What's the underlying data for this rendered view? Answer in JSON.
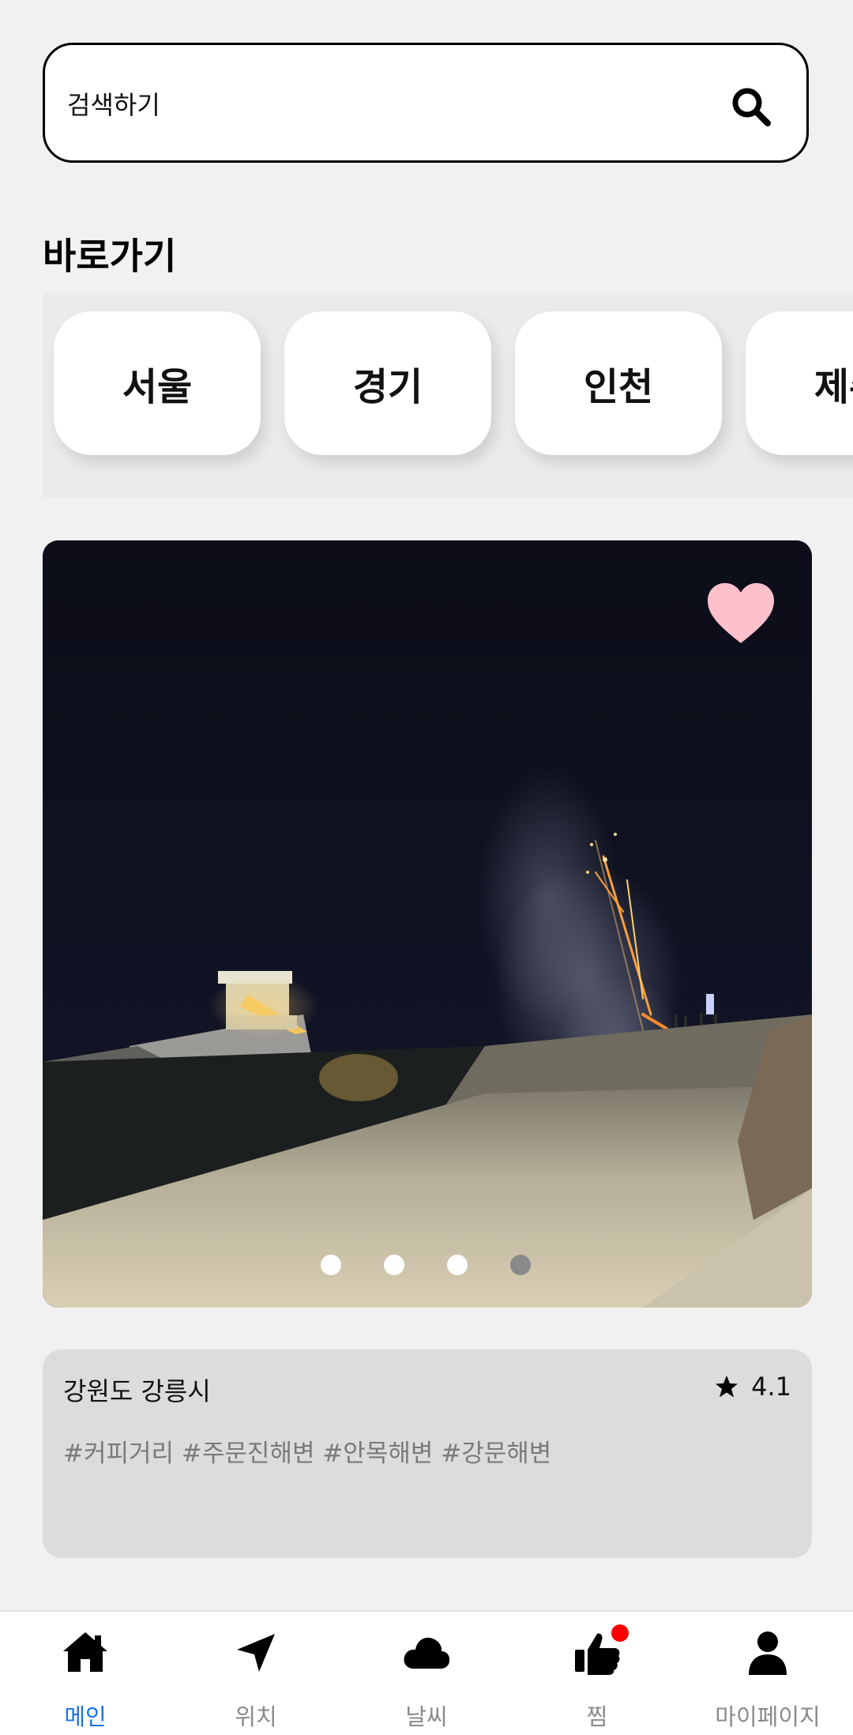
{
  "search": {
    "placeholder": "검색하기",
    "icon": "search-icon"
  },
  "shortcuts": {
    "title": "바로가기",
    "items": [
      "서울",
      "경기",
      "인천",
      "제주"
    ]
  },
  "featured": {
    "liked": true,
    "heart_color": "#ffc0cb",
    "carousel": {
      "total": 4,
      "active_index": 3
    },
    "region": "강원도 강릉시",
    "rating": "4.1",
    "tags": "#커피거리 #주문진해변 #안목해변 #강문해변"
  },
  "nav": {
    "active_color": "#1a73e8",
    "items": [
      {
        "label": "메인",
        "icon": "home-icon",
        "active": true
      },
      {
        "label": "위치",
        "icon": "location-arrow-icon",
        "active": false
      },
      {
        "label": "날씨",
        "icon": "cloud-icon",
        "active": false
      },
      {
        "label": "찜",
        "icon": "thumbs-up-icon",
        "active": false,
        "badge": true
      },
      {
        "label": "마이페이지",
        "icon": "user-icon",
        "active": false
      }
    ]
  }
}
